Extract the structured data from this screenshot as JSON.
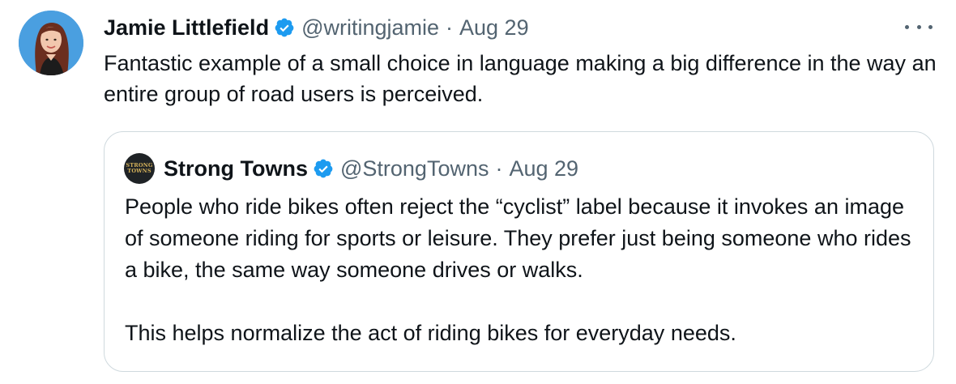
{
  "tweet": {
    "author_name": "Jamie Littlefield",
    "handle": "@writingjamie",
    "separator": "·",
    "date": "Aug 29",
    "text": "Fantastic example of a small choice in language making a big difference in the way an entire group of road users is perceived.",
    "avatar_icon": "profile-photo",
    "verified_icon": "verified-badge-icon",
    "more_icon": "more-options-icon"
  },
  "quoted": {
    "author_name": "Strong Towns",
    "handle": "@StrongTowns",
    "separator": "·",
    "date": "Aug 29",
    "logo_line1": "STRONG",
    "logo_line2": "TOWNS",
    "paragraph1": "People who ride bikes often reject the “cyclist” label because it invokes an image of someone riding for sports or leisure. They prefer just being someone who rides a bike, the same way someone drives or walks.",
    "paragraph2": "This helps normalize the act of riding bikes for everyday needs."
  },
  "colors": {
    "text": "#0f1419",
    "secondary": "#536471",
    "verified": "#1d9bf0",
    "border": "#cfd9de"
  }
}
